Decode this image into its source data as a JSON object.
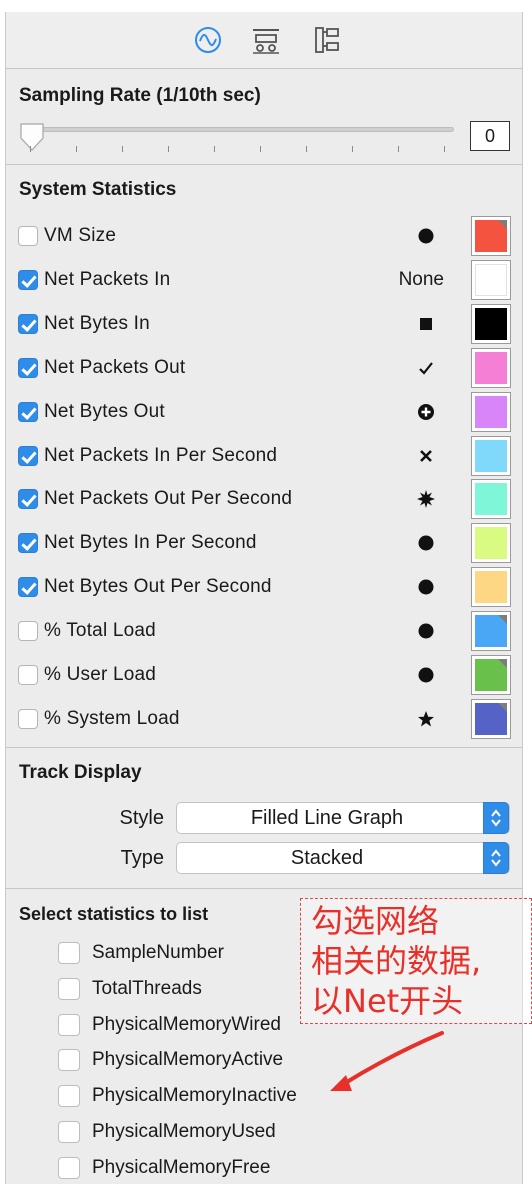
{
  "toolbar": {
    "icons": [
      "waveform-icon",
      "display-settings-icon",
      "tree-layout-icon"
    ]
  },
  "sampling": {
    "title": "Sampling Rate (1/10th sec)",
    "value": "0",
    "slider_position_fraction": 0.0
  },
  "system_statistics": {
    "title": "System Statistics",
    "items": [
      {
        "label": "VM Size",
        "checked": false,
        "marker": "circle",
        "color": "#f4533f",
        "corner": true
      },
      {
        "label": "Net Packets In",
        "checked": true,
        "marker": "None",
        "color": "#ffffff",
        "corner": false
      },
      {
        "label": "Net Bytes In",
        "checked": true,
        "marker": "square",
        "color": "#000000",
        "corner": false
      },
      {
        "label": "Net Packets Out",
        "checked": true,
        "marker": "check",
        "color": "#f57fd5",
        "corner": false
      },
      {
        "label": "Net Bytes Out",
        "checked": true,
        "marker": "plus-circle",
        "color": "#d785f9",
        "corner": false
      },
      {
        "label": "Net Packets In Per Second",
        "checked": true,
        "marker": "x",
        "color": "#80d9fb",
        "corner": false
      },
      {
        "label": "Net Packets Out Per Second",
        "checked": true,
        "marker": "star-burst",
        "color": "#80f6d8",
        "corner": false
      },
      {
        "label": "Net Bytes In Per Second",
        "checked": true,
        "marker": "circle",
        "color": "#d9fb82",
        "corner": false
      },
      {
        "label": "Net Bytes Out Per Second",
        "checked": true,
        "marker": "circle",
        "color": "#fed785",
        "corner": false
      },
      {
        "label": "% Total Load",
        "checked": false,
        "marker": "circle",
        "color": "#4aa7f5",
        "corner": true
      },
      {
        "label": "% User Load",
        "checked": false,
        "marker": "circle",
        "color": "#69c04a",
        "corner": true
      },
      {
        "label": "% System Load",
        "checked": false,
        "marker": "star",
        "color": "#5563c6",
        "corner": true
      }
    ]
  },
  "track_display": {
    "title": "Track Display",
    "style_label": "Style",
    "style_value": "Filled Line Graph",
    "type_label": "Type",
    "type_value": "Stacked"
  },
  "list_stats": {
    "title": "Select statistics to list",
    "items": [
      {
        "label": "SampleNumber"
      },
      {
        "label": "TotalThreads"
      },
      {
        "label": "PhysicalMemoryWired"
      },
      {
        "label": "PhysicalMemoryActive"
      },
      {
        "label": "PhysicalMemoryInactive"
      },
      {
        "label": "PhysicalMemoryUsed"
      },
      {
        "label": "PhysicalMemoryFree"
      }
    ]
  },
  "annotation": {
    "text": "勾选网络\n相关的数据,\n以Net开头",
    "color": "#e8302a"
  }
}
